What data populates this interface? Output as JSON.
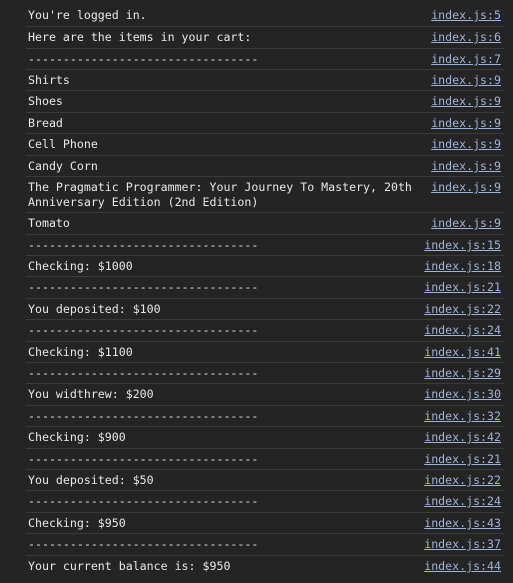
{
  "console": {
    "messages": [
      {
        "text": "You're logged in.",
        "source": "index.js:5"
      },
      {
        "text": "Here are the items in your cart:",
        "source": "index.js:6"
      },
      {
        "text": "---------------------------------",
        "source": "index.js:7"
      },
      {
        "text": "Shirts",
        "source": "index.js:9"
      },
      {
        "text": "Shoes",
        "source": "index.js:9"
      },
      {
        "text": "Bread",
        "source": "index.js:9"
      },
      {
        "text": "Cell Phone",
        "source": "index.js:9"
      },
      {
        "text": "Candy Corn",
        "source": "index.js:9"
      },
      {
        "text": "The Pragmatic Programmer: Your Journey To Mastery, 20th Anniversary Edition (2nd Edition)",
        "source": "index.js:9"
      },
      {
        "text": "Tomato",
        "source": "index.js:9"
      },
      {
        "text": "---------------------------------",
        "source": "index.js:15"
      },
      {
        "text": "Checking: $1000",
        "source": "index.js:18"
      },
      {
        "text": "---------------------------------",
        "source": "index.js:21"
      },
      {
        "text": "You deposited: $100",
        "source": "index.js:22"
      },
      {
        "text": "---------------------------------",
        "source": "index.js:24"
      },
      {
        "text": "Checking: $1100",
        "source": "index.js:41"
      },
      {
        "text": "---------------------------------",
        "source": "index.js:29"
      },
      {
        "text": "You widthrew: $200",
        "source": "index.js:30"
      },
      {
        "text": "---------------------------------",
        "source": "index.js:32"
      },
      {
        "text": "Checking: $900",
        "source": "index.js:42"
      },
      {
        "text": "---------------------------------",
        "source": "index.js:21"
      },
      {
        "text": "You deposited: $50",
        "source": "index.js:22"
      },
      {
        "text": "---------------------------------",
        "source": "index.js:24"
      },
      {
        "text": "Checking: $950",
        "source": "index.js:43"
      },
      {
        "text": "---------------------------------",
        "source": "index.js:37"
      },
      {
        "text": "Your current balance is: $950",
        "source": "index.js:44"
      }
    ]
  }
}
